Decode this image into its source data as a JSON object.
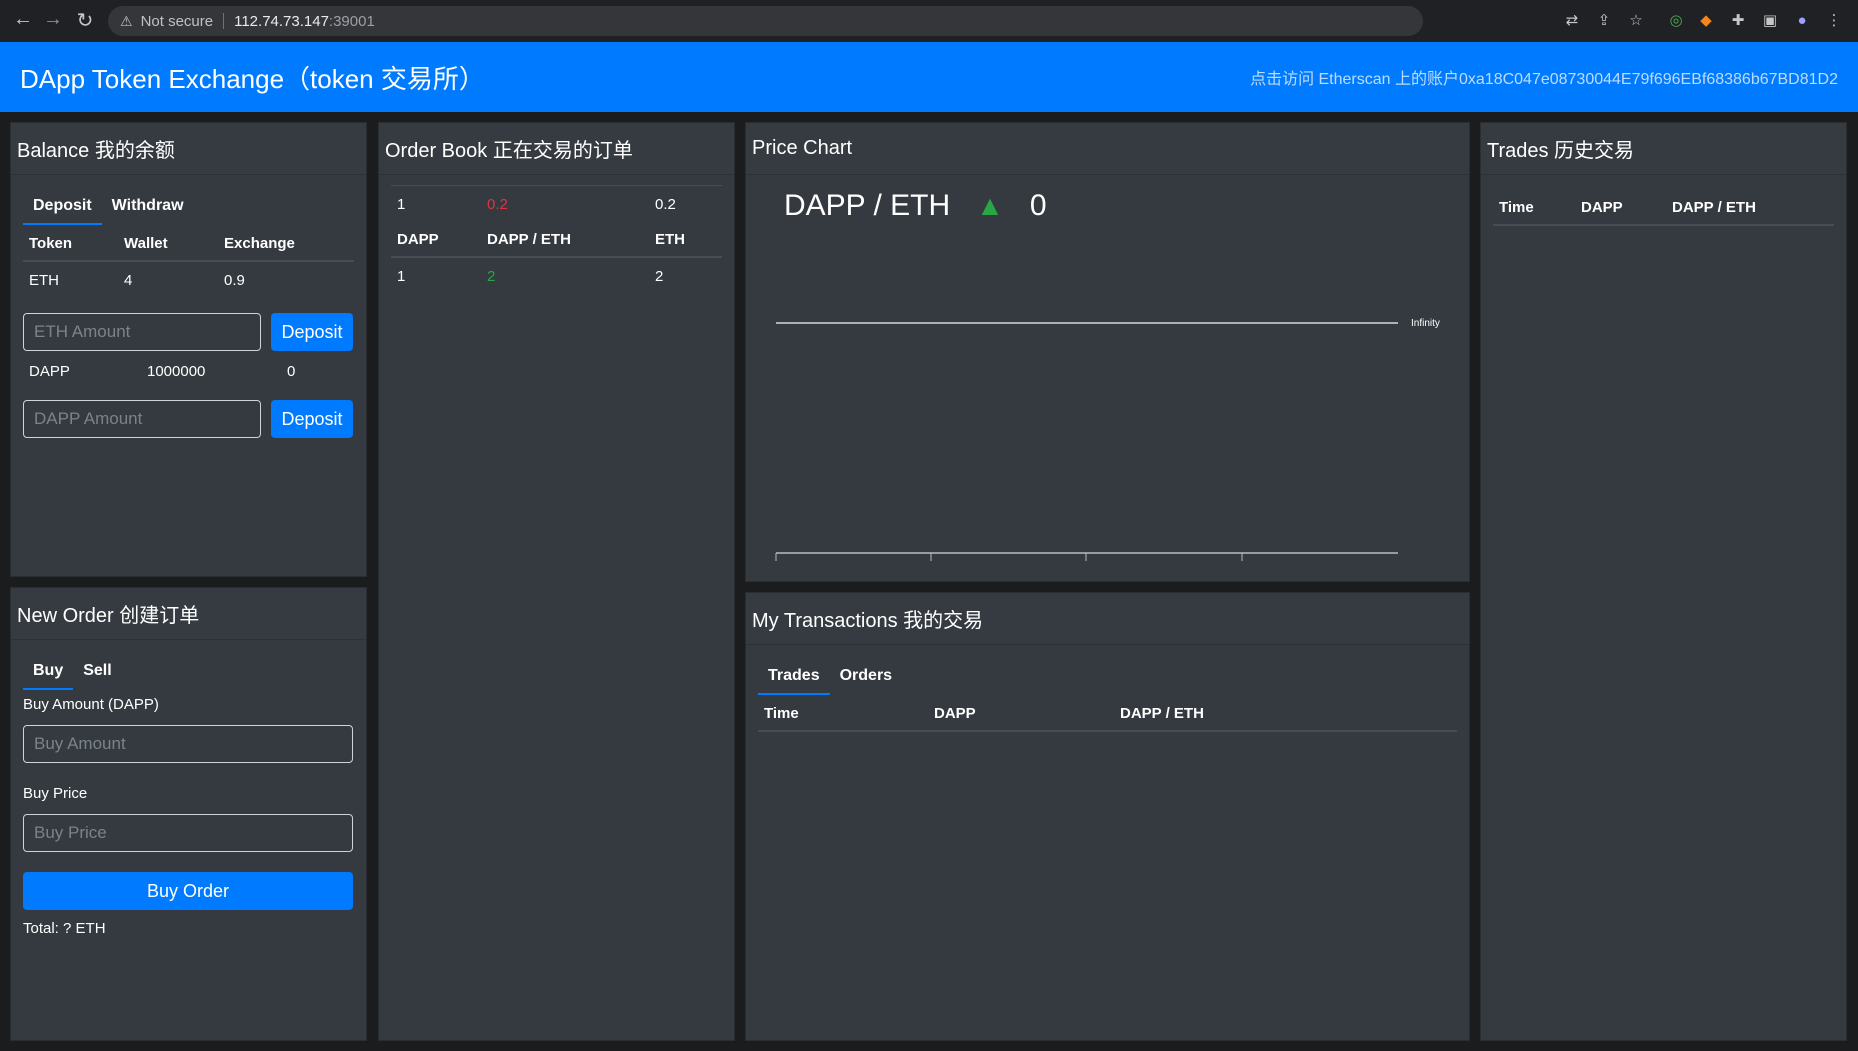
{
  "browser": {
    "security_label": "Not secure",
    "url_host": "112.74.73.147",
    "url_port": ":39001"
  },
  "header": {
    "title": "DApp Token Exchange（token 交易所）",
    "account_link": "点击访问 Etherscan 上的账户0xa18C047e08730044E79f696EBf68386b67BD81D2"
  },
  "balance": {
    "title": "Balance 我的余额",
    "tabs": [
      "Deposit",
      "Withdraw"
    ],
    "columns": [
      "Token",
      "Wallet",
      "Exchange"
    ],
    "eth": {
      "token": "ETH",
      "wallet": "4",
      "exchange": "0.9"
    },
    "eth_placeholder": "ETH Amount",
    "dapp": {
      "token": "DAPP",
      "wallet": "1000000",
      "exchange": "0"
    },
    "dapp_placeholder": "DAPP Amount",
    "deposit_label": "Deposit"
  },
  "order_book": {
    "title": "Order Book 正在交易的订单",
    "sell_row": {
      "dapp": "1",
      "price": "0.2",
      "eth": "0.2"
    },
    "columns": [
      "DAPP",
      "DAPP / ETH",
      "ETH"
    ],
    "buy_row": {
      "dapp": "1",
      "price": "2",
      "eth": "2"
    }
  },
  "price_chart": {
    "title": "Price Chart",
    "pair": "DAPP / ETH",
    "arrow": "▲",
    "price": "0",
    "axis_label": "Infinity"
  },
  "transactions": {
    "title": "My Transactions 我的交易",
    "tabs": [
      "Trades",
      "Orders"
    ],
    "columns": [
      "Time",
      "DAPP",
      "DAPP / ETH"
    ]
  },
  "trades": {
    "title": "Trades 历史交易",
    "columns": [
      "Time",
      "DAPP",
      "DAPP / ETH"
    ]
  },
  "new_order": {
    "title": "New Order 创建订单",
    "tabs": [
      "Buy",
      "Sell"
    ],
    "amount_label": "Buy Amount (DAPP)",
    "amount_placeholder": "Buy Amount",
    "price_label": "Buy Price",
    "price_placeholder": "Buy Price",
    "submit_label": "Buy Order",
    "total": "Total: ? ETH"
  },
  "colors": {
    "primary": "#007bff",
    "card": "#343a40",
    "sell": "#dc3545",
    "buy": "#28a745"
  }
}
